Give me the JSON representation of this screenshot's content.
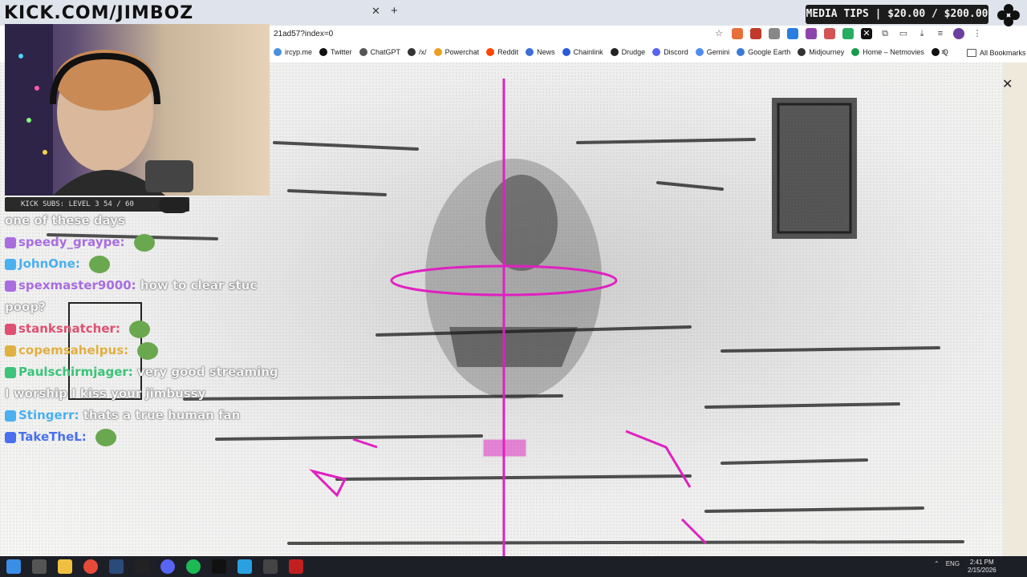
{
  "overlay": {
    "logo_text": "KICK.COM/JIMBOZ",
    "subs_label": "KICK SUBS: LEVEL 3 54 / 60",
    "media_tips": "MEDIA TIPS | $20.00 / $200.00"
  },
  "browser": {
    "url": "21ad57?index=0",
    "bookmarks": [
      {
        "label": "ircyp.me",
        "color": "#4a90d9"
      },
      {
        "label": "Twitter",
        "color": "#111111"
      },
      {
        "label": "ChatGPT",
        "color": "#555555"
      },
      {
        "label": "/x/",
        "color": "#333333"
      },
      {
        "label": "Powerchat",
        "color": "#e8a020"
      },
      {
        "label": "Reddit",
        "color": "#ff4500"
      },
      {
        "label": "News",
        "color": "#3b6fd4"
      },
      {
        "label": "Chainlink",
        "color": "#2a5ada"
      },
      {
        "label": "Drudge",
        "color": "#222222"
      },
      {
        "label": "Discord",
        "color": "#5865f2"
      },
      {
        "label": "Gemini",
        "color": "#4f8bf0"
      },
      {
        "label": "Google Earth",
        "color": "#3a7bd5"
      },
      {
        "label": "Midjourney",
        "color": "#333333"
      },
      {
        "label": "Home – Netmovies",
        "color": "#1a9c4a"
      },
      {
        "label": "Q",
        "color": "#111111"
      }
    ],
    "bookmarks_overflow_icon": "chevron-right-icon",
    "all_bookmarks": "All Bookmarks"
  },
  "chat": [
    {
      "name": "",
      "text": "one of these days",
      "name_color": "#ffffff"
    },
    {
      "name": "speedy_graype:",
      "text": "",
      "name_color": "#a86ee0"
    },
    {
      "name": "JohnOne:",
      "text": "",
      "name_color": "#4ab0f0"
    },
    {
      "name": "spexmaster9000:",
      "text": "how to clear stuc poop?",
      "name_color": "#a86ee0"
    },
    {
      "name": "stanksnatcher:",
      "text": "",
      "name_color": "#e05070"
    },
    {
      "name": "copemsahelpus:",
      "text": "",
      "name_color": "#e0b040"
    },
    {
      "name": "Paulschirmjager:",
      "text": "very good streaming I worship I kiss your jimbussy",
      "name_color": "#3cc47a"
    },
    {
      "name": "Stingerr:",
      "text": "thats a true human fan",
      "name_color": "#4ab0f0"
    },
    {
      "name": "TakeTheL:",
      "text": "",
      "name_color": "#4a70f0"
    }
  ],
  "taskbar": {
    "lang": "ENG",
    "time": "2:41 PM",
    "date": "2/15/2026"
  },
  "colors": {
    "highlight": "#e020c0",
    "chrome_bg": "#dfe3eb",
    "taskbar_bg": "#1d1f27"
  }
}
